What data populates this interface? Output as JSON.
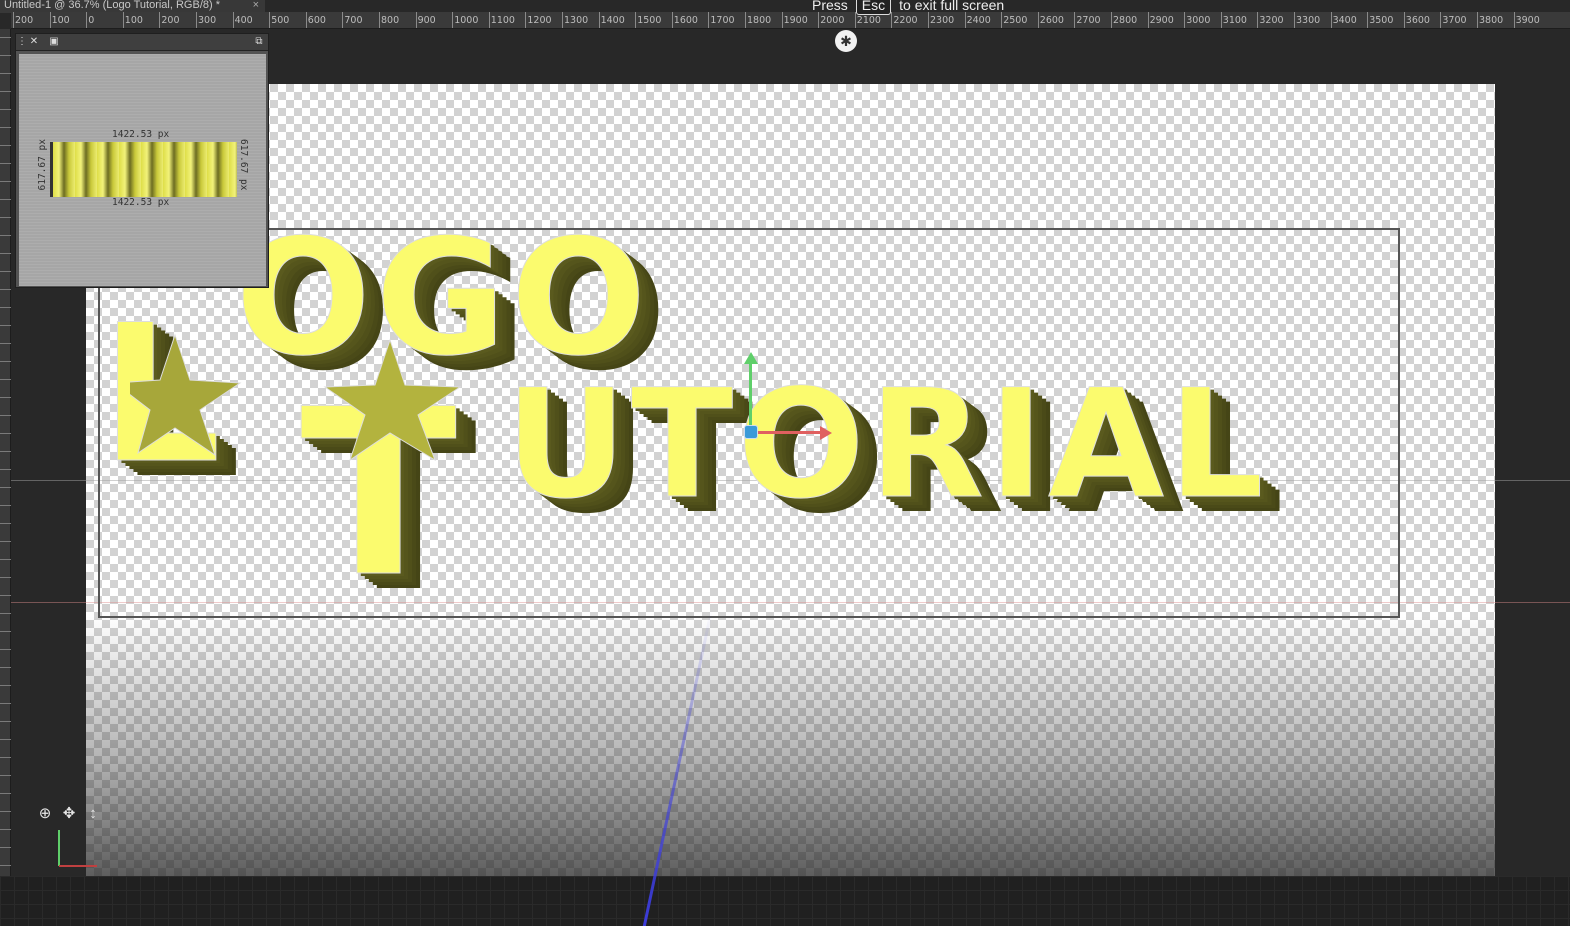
{
  "document_tab": {
    "title": "Untitled-1 @ 36.7% (Logo   Tutorial, RGB/8) *",
    "close": "×"
  },
  "ruler": {
    "labels": [
      "200",
      "100",
      "0",
      "100",
      "200",
      "300",
      "400",
      "500",
      "600",
      "700",
      "800",
      "900",
      "1000",
      "1100",
      "1200",
      "1300",
      "1400",
      "1500",
      "1600",
      "1700",
      "1800",
      "1900",
      "2000",
      "2100",
      "2200",
      "2300",
      "2400",
      "2500",
      "2600",
      "2700",
      "2800",
      "2900",
      "3000",
      "3100",
      "3200",
      "3300",
      "3400",
      "3500",
      "3600",
      "3700",
      "3800",
      "3900"
    ]
  },
  "fullscreen_notice": {
    "press": "Press",
    "key": "Esc",
    "message": "to exit full screen"
  },
  "canvas": {
    "line1_L": "L",
    "line1_rest": "OGO",
    "line2_T": "T",
    "line2_rest": "UTORIAL",
    "text_color": "#fbfb6e",
    "extrusion_color": "#4e4e1a"
  },
  "panel": {
    "width_top": "1422.53 px",
    "width_bottom": "1422.53 px",
    "height_left": "617.67 px",
    "height_right": "617.67 px"
  },
  "tools": {
    "orbit_icon": "⊕",
    "pan_icon": "✥",
    "slide_icon": "↕"
  }
}
